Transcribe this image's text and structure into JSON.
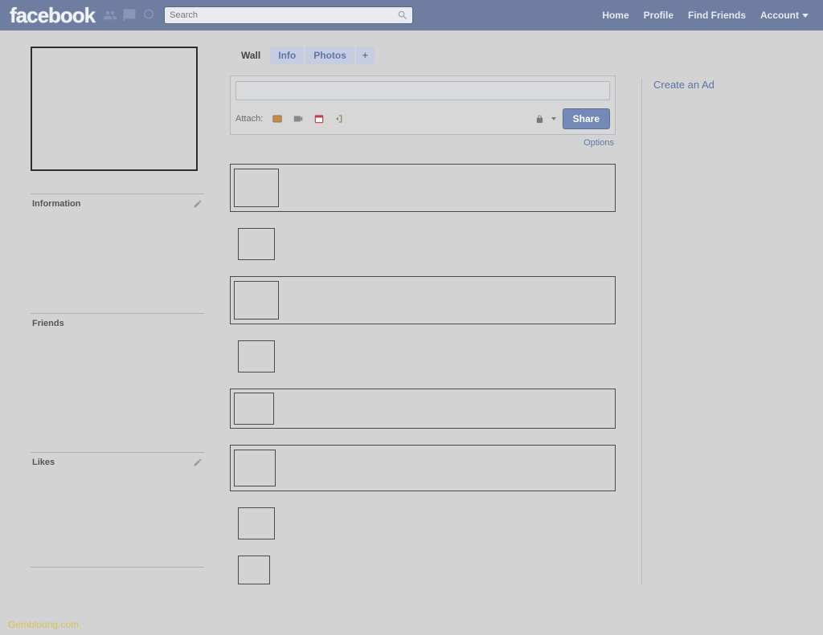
{
  "brand": "facebook",
  "search": {
    "placeholder": "Search"
  },
  "nav": {
    "home": "Home",
    "profile": "Profile",
    "find_friends": "Find Friends",
    "account": "Account"
  },
  "sidebar": {
    "information": "Information",
    "friends": "Friends",
    "likes": "Likes"
  },
  "tabs": {
    "wall": "Wall",
    "info": "Info",
    "photos": "Photos",
    "add": "+"
  },
  "composer": {
    "attach_label": "Attach:",
    "share": "Share",
    "options": "Options"
  },
  "right": {
    "create_ad": "Create an Ad"
  },
  "watermark": "Gembloong.com"
}
